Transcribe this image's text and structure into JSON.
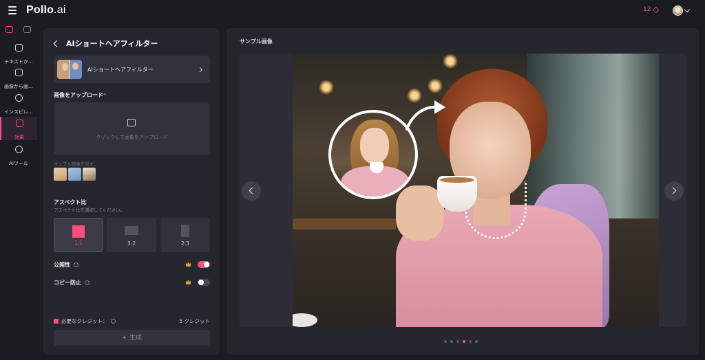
{
  "header": {
    "brand": "Pollo",
    "brand_suffix": ".ai",
    "credits": "12"
  },
  "sidebar": {
    "items": [
      {
        "label": "テキストか…"
      },
      {
        "label": "画像から画…"
      },
      {
        "label": "インスピレ…"
      },
      {
        "label": "効果"
      },
      {
        "label": "AIツール"
      }
    ]
  },
  "panel": {
    "title": "AIショートヘアフィルター",
    "filter_card_label": "AIショートヘアフィルター",
    "upload_label": "画像をアップロード",
    "required_mark": "*",
    "upload_hint": "クリックして画像をアップロード",
    "sample_label": "サンプル画像を試す",
    "aspect_label": "アスペクト比",
    "aspect_sub": "アスペクト比を選択してください。",
    "ratios": [
      {
        "label": "1:1",
        "selected": true
      },
      {
        "label": "3:2",
        "selected": false
      },
      {
        "label": "2:3",
        "selected": false
      }
    ],
    "public_label": "公開性",
    "public_on": true,
    "copy_protect_label": "コピー防止",
    "copy_protect_on": false,
    "credits_required_label": "必要なクレジット：",
    "credits_required_value": "5 クレジット",
    "generate_label": "生成"
  },
  "main": {
    "title": "サンプル画像",
    "carousel": {
      "count": 6,
      "active_index": 3
    }
  },
  "colors": {
    "accent": "#ff4d7d",
    "background": "#1b1b22",
    "panel": "#26262f"
  }
}
